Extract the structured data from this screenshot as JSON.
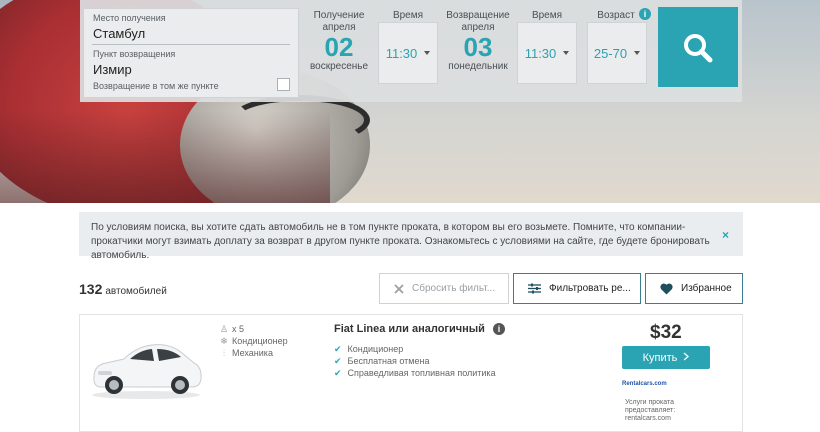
{
  "search": {
    "pickup_label": "Место получения",
    "pickup_value": "Стамбул",
    "return_label": "Пункт возвращения",
    "return_value": "Измир",
    "same_return_label": "Возвращение в том же пункте",
    "same_return_checked": false,
    "pickup_heading": "Получение",
    "pickup_month": "апреля",
    "pickup_day": "02",
    "pickup_weekday": "воскресенье",
    "time_heading": "Время",
    "pickup_time": "11:30",
    "return_heading": "Возвращение",
    "return_month": "апреля",
    "return_day": "03",
    "return_weekday": "понедельник",
    "return_time_heading": "Время",
    "return_time": "11:30",
    "age_heading": "Возраст",
    "age_value": "25-70",
    "search_icon": "magnifier-icon",
    "accent_color": "#2aa3b3"
  },
  "notice": {
    "text": "По условиям поиска, вы хотите сдать автомобиль не в том пункте проката, в котором вы его возьмете. Помните, что компании-прокатчики могут взимать доплату за возврат в другом пункте проката. Ознакомьтесь с условиями на сайте, где будете бронировать автомобиль.",
    "close": "×"
  },
  "results": {
    "count": "132",
    "count_label": "автомобилей",
    "reset_label": "Сбросить фильт...",
    "filter_label": "Фильтровать ре...",
    "favorites_label": "Избранное"
  },
  "car": {
    "seats": "x 5",
    "ac": "Кондиционер",
    "transmission": "Механика",
    "name": "Fiat Linea или аналогичный",
    "features": [
      "Кондиционер",
      "Бесплатная отмена",
      "Справедливая топливная политика"
    ],
    "price": "$32",
    "buy_label": "Купить",
    "provider_logo": "Rentalcars.com",
    "provider_line1": "Услуги проката",
    "provider_line2": "предоставляет:",
    "provider_line3": "rentalcars.com"
  }
}
